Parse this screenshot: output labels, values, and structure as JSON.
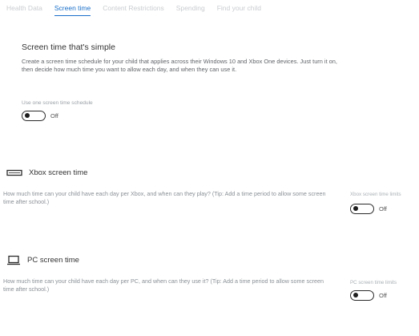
{
  "tabs": [
    {
      "label": "Health Data",
      "active": false
    },
    {
      "label": "Screen time",
      "active": true
    },
    {
      "label": "Content Restrictions",
      "active": false
    },
    {
      "label": "Spending",
      "active": false
    },
    {
      "label": "Find your child",
      "active": false
    }
  ],
  "simple": {
    "title": "Screen time that's simple",
    "description": "Create a screen time schedule for your child that applies across their Windows 10 and Xbox One devices. Just turn it on, then decide how much time you want to allow each day, and when they can use it.",
    "toggle_label": "Use one screen time schedule",
    "toggle_state": "Off"
  },
  "xbox": {
    "title": "Xbox screen time",
    "icon": "xbox-console-icon",
    "description": "How much time can your child have each day per Xbox, and when can they play? (Tip: Add a time period to allow some screen time after school.)",
    "side_label": "Xbox screen time limits",
    "toggle_state": "Off"
  },
  "pc": {
    "title": "PC screen time",
    "icon": "laptop-icon",
    "description": "How much time can your child have each day per PC, and when can they use it? (Tip: Add a time period to allow some screen time after school.)",
    "side_label": "PC screen time limits",
    "toggle_state": "Off"
  },
  "colors": {
    "accent": "#1a6fc9",
    "faded_tab": "#c9ccd0"
  }
}
